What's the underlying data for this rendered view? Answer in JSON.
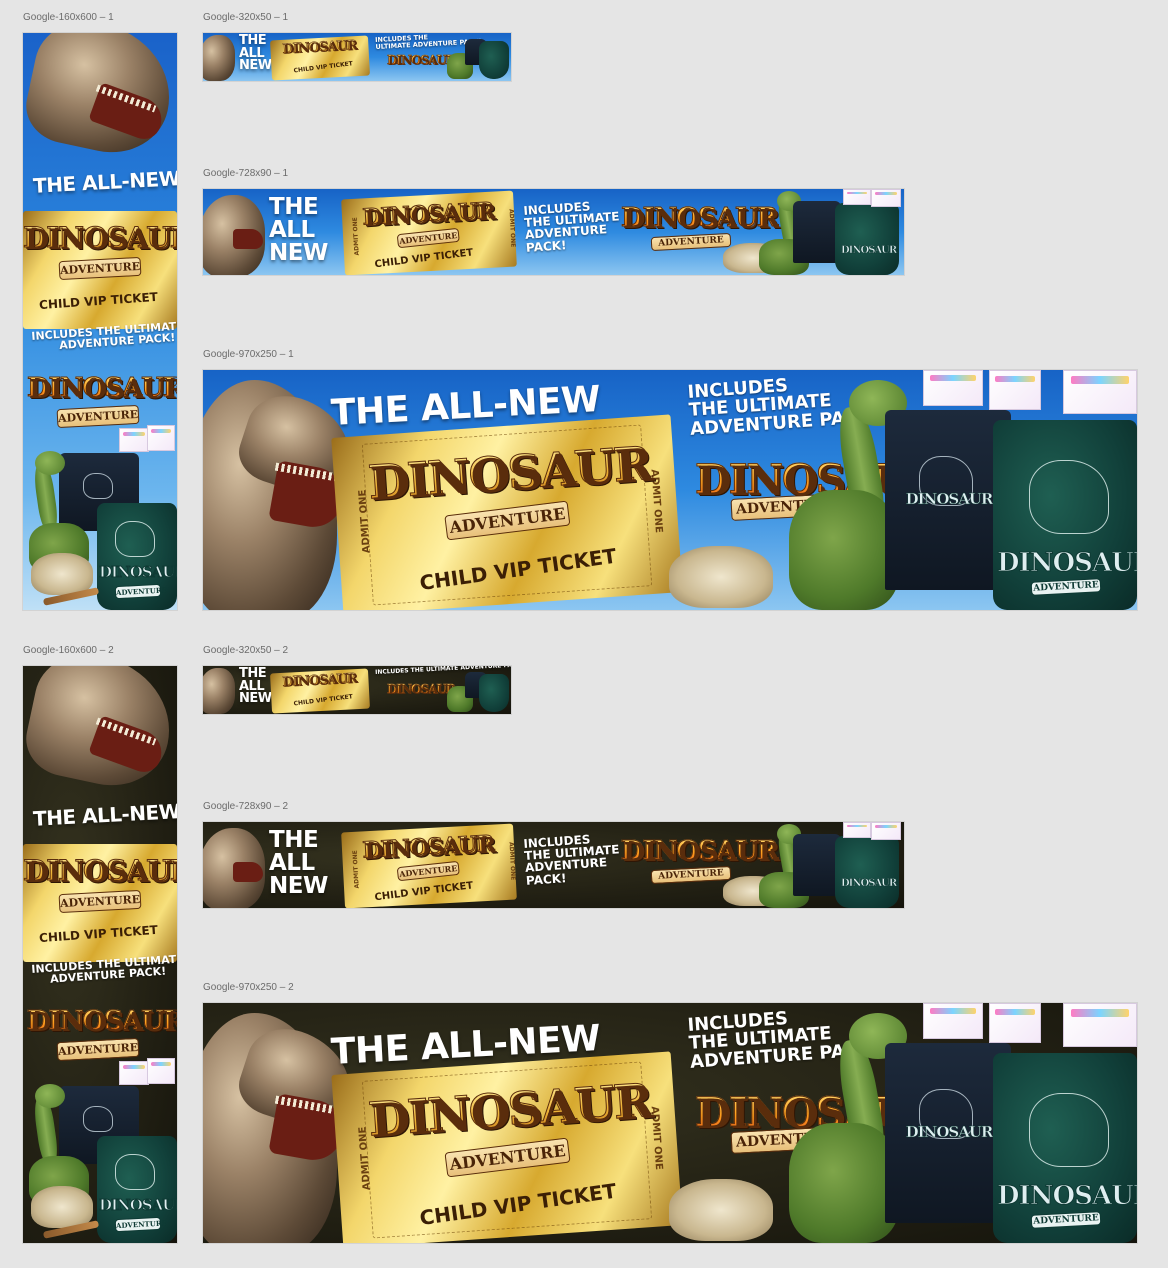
{
  "labels": {
    "sky_160": "Google-160x600 – 1",
    "sky_320": "Google-320x50 – 1",
    "sky_728": "Google-728x90 – 1",
    "sky_970": "Google-970x250 – 1",
    "dark_160": "Google-160x600 – 2",
    "dark_320": "Google-320x50 – 2",
    "dark_728": "Google-728x90 – 2",
    "dark_970": "Google-970x250 – 2"
  },
  "copy": {
    "the_all_new": "THE ALL-NEW",
    "the": "THE",
    "all": "ALL",
    "new": "NEW",
    "includes_3l_1": "INCLUDES",
    "includes_3l_2": "THE ULTIMATE",
    "includes_3l_3": "ADVENTURE PACK!",
    "includes_2l_1": "INCLUDES THE ULTIMATE",
    "includes_2l_2": "ADVENTURE PACK!",
    "includes_4l_1": "INCLUDES",
    "includes_4l_2": "THE ULTIMATE",
    "includes_4l_3": "ADVENTURE",
    "includes_4l_4": "PACK!",
    "includes_mini_1": "INCLUDES THE",
    "includes_mini_2": "ULTIMATE ADVENTURE PACK!",
    "includes_mini_dark_1": "INCLUDES THE ULTIMATE ADVENTURE PACK!"
  },
  "logo": {
    "dinosaur": "DINOSAUR",
    "adventure": "ADVENTURE"
  },
  "ticket": {
    "admit": "ADMIT ONE",
    "vip": "CHILD VIP TICKET"
  },
  "colors": {
    "sky_top": "#1a62c9",
    "sky_bottom": "#bfe0f6",
    "dark_bg": "#232114",
    "gold": "#f3d66b",
    "canvas": "#e5e5e5"
  }
}
